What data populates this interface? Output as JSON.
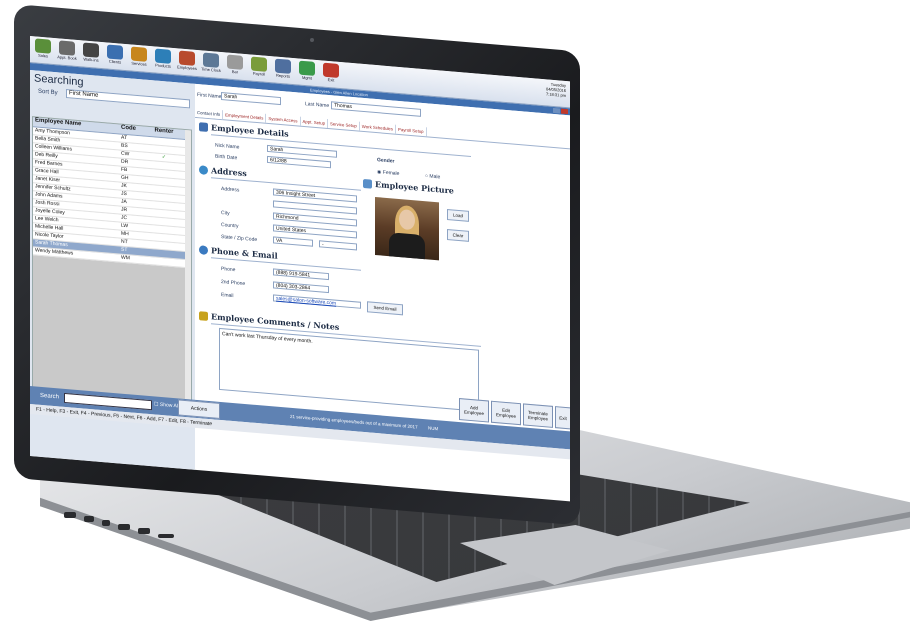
{
  "toolbar": {
    "items": [
      "Sales",
      "Appt. Book",
      "Walk-ins",
      "Clients",
      "Services",
      "Products",
      "Employees",
      "Time Clock",
      "Bar",
      "Payroll",
      "Reports",
      "Mgmt",
      "Exit"
    ],
    "date_line1": "Tuesday",
    "date_line2": "04/05/2016",
    "time": "7:18:31 pm"
  },
  "window": {
    "title": "Employees - Glen Allen Location"
  },
  "left": {
    "title": "Searching",
    "sort_label": "Sort By",
    "sort_value": "First Name",
    "columns": [
      "Employee Name",
      "Code",
      "Renter"
    ],
    "rows": [
      {
        "name": "Amy Thompson",
        "code": "AT",
        "renter": ""
      },
      {
        "name": "Bella Smith",
        "code": "BS",
        "renter": ""
      },
      {
        "name": "Colleen Williams",
        "code": "CW",
        "renter": "✓"
      },
      {
        "name": "Deb Reilly",
        "code": "DR",
        "renter": ""
      },
      {
        "name": "Fred Barnes",
        "code": "FB",
        "renter": ""
      },
      {
        "name": "Grace Hall",
        "code": "GH",
        "renter": ""
      },
      {
        "name": "Janet Kiser",
        "code": "JK",
        "renter": ""
      },
      {
        "name": "Jennifer Schultz",
        "code": "JS",
        "renter": ""
      },
      {
        "name": "John Adams",
        "code": "JA",
        "renter": ""
      },
      {
        "name": "Josh Rossi",
        "code": "JR",
        "renter": ""
      },
      {
        "name": "Joyelle Coley",
        "code": "JC",
        "renter": ""
      },
      {
        "name": "Lee Welch",
        "code": "LW",
        "renter": ""
      },
      {
        "name": "Michelle Hall",
        "code": "MH",
        "renter": ""
      },
      {
        "name": "Nicole Taylor",
        "code": "NT",
        "renter": ""
      },
      {
        "name": "Sarah Thomas",
        "code": "ST",
        "renter": "",
        "selected": true
      },
      {
        "name": "Wendy Matthews",
        "code": "WM",
        "renter": ""
      }
    ]
  },
  "bottom": {
    "search_label": "Search",
    "show_all": "Show All",
    "actions": "Actions",
    "status": "21 service-providing employees/beds out of a maximum of 2017",
    "num": "NUM",
    "help": "F1 - Help, F3 - Exit, F4 - Previous, F5 - Next, F6 - Add, F7 - Edit, F8 - Terminate"
  },
  "form": {
    "first_name_label": "First Name",
    "first_name": "Sarah",
    "last_name_label": "Last Name",
    "last_name": "Thomas",
    "tabs": [
      "Contact Info",
      "Employment Details",
      "System Access",
      "Appt. Setup",
      "Service Setup",
      "Work Schedules",
      "Payroll Setup"
    ],
    "employee_details_title": "Employee Details",
    "nick_name_label": "Nick Name",
    "nick_name": "Sarah",
    "birth_date_label": "Birth Date",
    "birth_date": "6/12/88",
    "gender_label": "Gender",
    "gender_female": "Female",
    "gender_male": "Male",
    "address_title": "Address",
    "address_label": "Address",
    "address_line1": "306 Insight Street",
    "address_line2": "",
    "city_label": "City",
    "city": "Richmond",
    "country_label": "Country",
    "country": "United States",
    "state_zip_label": "State / Zip Code",
    "state": "VA",
    "zip": "-",
    "picture_title": "Employee Picture",
    "load": "Load",
    "clear": "Clear",
    "phone_title": "Phone & Email",
    "phone_label": "Phone",
    "phone": "(888) 919-5841",
    "phone2_label": "2nd Phone",
    "phone2": "(804) 303-2864",
    "email_label": "Email",
    "email": "sales@salon-software.com",
    "send_email": "Send Email",
    "comments_title": "Employee Comments / Notes",
    "comments": "Can't work last Thursday of every month.",
    "add_employee": "Add Employee",
    "edit_employee": "Edit Employee",
    "terminate_employee": "Terminate Employee",
    "exit": "Exit"
  }
}
